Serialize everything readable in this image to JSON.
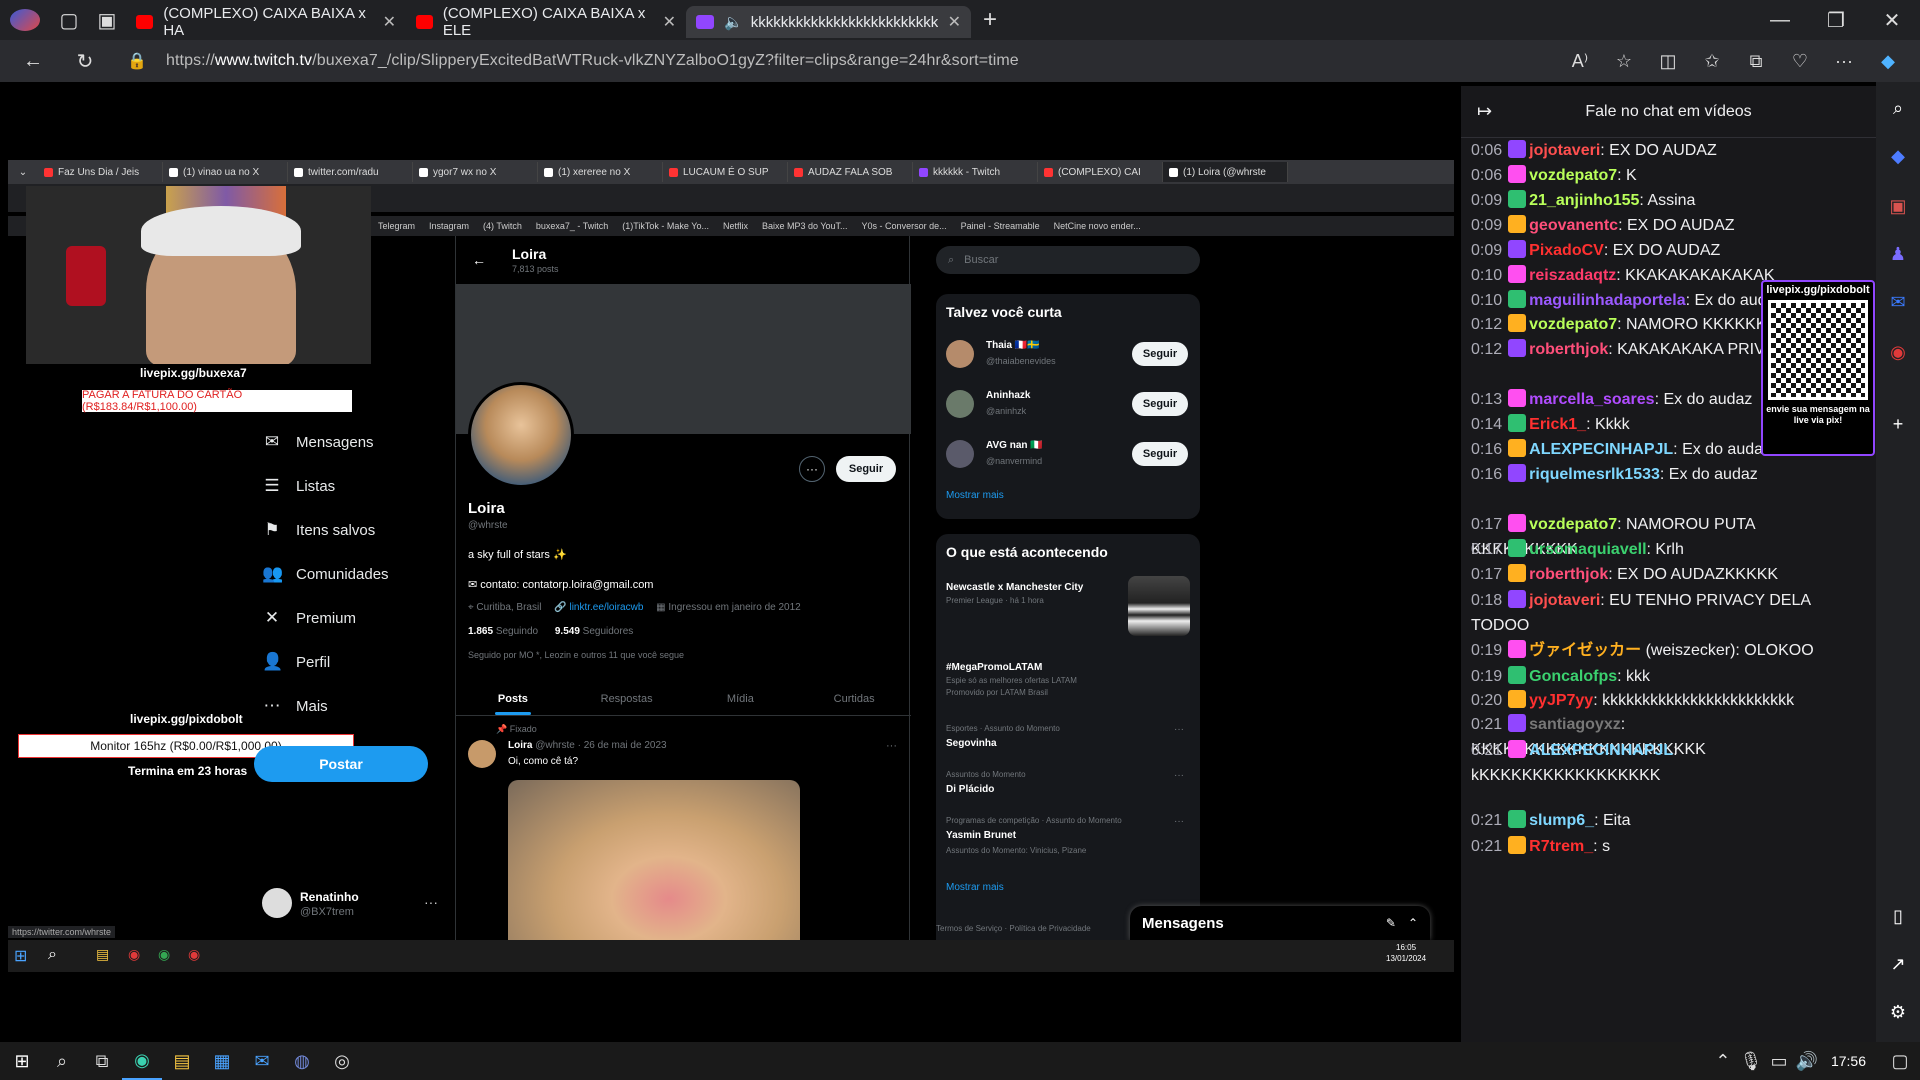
{
  "browser": {
    "tabs": [
      {
        "label": "(COMPLEXO) CAIXA BAIXA x HA",
        "icon": "youtube-icon"
      },
      {
        "label": "(COMPLEXO) CAIXA BAIXA x ELE",
        "icon": "youtube-icon"
      },
      {
        "label": "kkkkkkkkkkkkkkkkkkkkkkkkk",
        "icon": "twitch-icon",
        "active": true
      }
    ],
    "url_prefix": "https://",
    "url_domain": "www.twitch.tv",
    "url_path": "/buxexa7_/clip/SlipperyExcitedBatWTRuck-vlkZNYZalboO1gyZ?filter=clips&range=24hr&sort=time"
  },
  "stream": {
    "inner_tabs": [
      "Faz Uns Dia / Jeis",
      "(1) vinao ua no X",
      "twitter.com/radu",
      "ygor7 wx no X",
      "(1) xereree no X",
      "LUCAUM É O SUP",
      "AUDAZ FALA SOB",
      "kkkkkk - Twitch",
      "(COMPLEXO) CAI",
      "(1) Loira (@whrste"
    ],
    "bookmarks": [
      "Telegram",
      "Instagram",
      "(4) Twitch",
      "buxexa7_ - Twitch",
      "(1)TikTok - Make Yo...",
      "Netflix",
      "Baixe MP3 do YouT...",
      "Y0s - Conversor de...",
      "Painel - Streamable",
      "NetCine novo ender..."
    ],
    "overlay_pix": "livepix.gg/buxexa7",
    "overlay_goal": "PAGAR A FATURA DO CARTÃO (R$183.84/R$1,100.00)",
    "overlay_pix2": "livepix.gg/pixdobolt",
    "overlay_goal2": "Monitor 165hz (R$0.00/R$1,000.00)",
    "overlay_ends": "Termina em 23 horas",
    "twitter_nav": [
      "Mensagens",
      "Listas",
      "Itens salvos",
      "Comunidades",
      "Premium",
      "Perfil",
      "Mais"
    ],
    "post_button": "Postar",
    "account_name": "Renatinho",
    "account_handle": "@BX7trem",
    "status_url": "https://twitter.com/whrste",
    "profile": {
      "header_name": "Loira",
      "header_posts": "7,813 posts",
      "name": "Loira",
      "handle": "@whrste",
      "bio": "a sky full of stars ✨",
      "contact": "contato: contatorp.loira@gmail.com",
      "location": "Curitiba, Brasil",
      "link": "linktr.ee/loiracwb",
      "joined": "Ingressou em janeiro de 2012",
      "following_count": "1.865",
      "following_label": "Seguindo",
      "followers_count": "9.549",
      "followers_label": "Seguidores",
      "followed_by": "Seguido por MO *, Leozin e outros 11 que você segue",
      "follow_label": "Seguir",
      "tabs": [
        "Posts",
        "Respostas",
        "Mídia",
        "Curtidas"
      ],
      "pinned_label": "Fixado",
      "post_author": "Loira",
      "post_meta": "@whrste · 26 de mai de 2023",
      "post_text": "Oi, como cê tá?"
    },
    "search_placeholder": "Buscar",
    "suggest_title": "Talvez você curta",
    "suggestions": [
      {
        "name": "Thaia 🇫🇷🇸🇪",
        "handle": "@thaiabenevides"
      },
      {
        "name": "Aninhazk",
        "handle": "@aninhzk"
      },
      {
        "name": "AVG nan 🇮🇹",
        "handle": "@nanvermind"
      }
    ],
    "show_more": "Mostrar mais",
    "trends_title": "O que está acontecendo",
    "trends": [
      {
        "meta": "",
        "title": "Newcastle x Manchester City",
        "sub": "Premier League · há 1 hora"
      },
      {
        "meta": "",
        "title": "#MegaPromoLATAM",
        "sub": "Espie só as melhores ofertas LATAM"
      },
      {
        "meta": "Esportes · Assunto do Momento",
        "title": "Segovinha",
        "sub": ""
      },
      {
        "meta": "Assuntos do Momento",
        "title": "Di Plácido",
        "sub": ""
      },
      {
        "meta": "Programas de competição · Assunto do Momento",
        "title": "Yasmin Brunet",
        "sub": "Assuntos do Momento: Vinicius, Pizane"
      }
    ],
    "promoted": "Promovido por LATAM Brasil",
    "messages_drawer": "Mensagens",
    "footer_links": "Termos de Serviço · Política de Privacidade",
    "clock_time": "16:05",
    "clock_date": "13/01/2024"
  },
  "chat": {
    "title": "Fale no chat em vídeos",
    "qr_top": "livepix.gg/pixdobolt",
    "qr_bottom": "envie sua mensagem na live via pix!",
    "messages": [
      {
        "time": "0:06",
        "user": "jojotaveri",
        "color": "#ff4f4f",
        "text": ": EX DO AUDAZ"
      },
      {
        "time": "0:06",
        "user": "vozdepato7",
        "color": "#b9ff5a",
        "text": ": K"
      },
      {
        "time": "0:09",
        "user": "21_anjinho155",
        "color": "#b9ff5a",
        "text": ": Assina"
      },
      {
        "time": "0:09",
        "user": "geovanentc",
        "color": "#ff4f7a",
        "text": ": EX DO AUDAZ"
      },
      {
        "time": "0:09",
        "user": "PixadoCV",
        "color": "#ff3030",
        "text": ": EX DO AUDAZ"
      },
      {
        "time": "0:10",
        "user": "reiszadaqtz",
        "color": "#ff3b6b",
        "text": ": KKAKAKAKAKAKAK"
      },
      {
        "time": "0:10",
        "user": "maguilinhadaportela",
        "color": "#9b59ff",
        "text": ": Ex do audaz"
      },
      {
        "time": "0:12",
        "user": "vozdepato7",
        "color": "#b9ff5a",
        "text": ": NAMORO KKKKKKKKKKK"
      },
      {
        "time": "0:12",
        "user": "roberthjok",
        "color": "#ff4f7a",
        "text": ": KAKAKAKAKA PRIVACY"
      },
      {
        "time": "0:13",
        "user": "marcella_soares",
        "color": "#b04cff",
        "text": ": Ex do audaz"
      },
      {
        "time": "0:14",
        "user": "Erick1_",
        "color": "#ff3030",
        "text": ": Kkkk"
      },
      {
        "time": "0:16",
        "user": "ALEXPECINHAPJL",
        "color": "#7fd7ff",
        "text": ": Ex do audaz"
      },
      {
        "time": "0:16",
        "user": "riquelmesrlk1533",
        "color": "#7fd7ff",
        "text": ": Ex do audaz"
      },
      {
        "time": "0:17",
        "user": "vozdepato7",
        "color": "#b9ff5a",
        "text": ": NAMOROU PUTA KKKKKKKKKK"
      },
      {
        "time": "0:17",
        "user": "ursomaquiavell",
        "color": "#3bd16f",
        "text": ": Krlh"
      },
      {
        "time": "0:17",
        "user": "roberthjok",
        "color": "#ff4f7a",
        "text": ": EX DO AUDAZKKKKK"
      },
      {
        "time": "0:18",
        "user": "jojotaveri",
        "color": "#ff4f4f",
        "text": ": EU TENHO PRIVACY DELA TODOO"
      },
      {
        "time": "0:19",
        "user": "ヴァイゼッカー",
        "color": "#ffb020",
        "text": " (weiszecker): OLOKOO"
      },
      {
        "time": "0:19",
        "user": "Goncalofps",
        "color": "#3bd16f",
        "text": ": kkk"
      },
      {
        "time": "0:20",
        "user": "yyJP7yy",
        "color": "#ff3030",
        "text": ": kkkkkkkkkkkkkkkkkkkkkkkk"
      },
      {
        "time": "0:21",
        "user": "santiagoyxz",
        "color": "#777",
        "text": ": KKKKKKKKKKKKKKKKKKKKKK"
      },
      {
        "time": "0:21",
        "user": "ALEXPECINHAPJL",
        "color": "#7fd7ff",
        "text": ": kKKKKKKKKKKKKKKKKK"
      },
      {
        "time": "0:21",
        "user": "slump6_",
        "color": "#7fd7ff",
        "text": ": Eita"
      },
      {
        "time": "0:21",
        "user": "R7trem_",
        "color": "#ff3030",
        "text": ": s"
      }
    ]
  },
  "taskbar": {
    "time": "17:56"
  }
}
